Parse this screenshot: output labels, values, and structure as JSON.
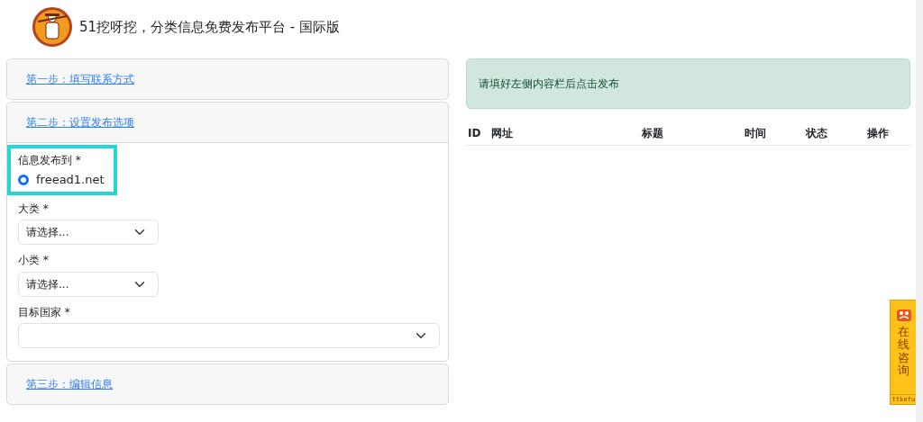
{
  "header": {
    "title": "51挖呀挖，分类信息免费发布平台 - 国际版"
  },
  "steps": [
    {
      "title": "第一步：填写联系方式",
      "expanded": false
    },
    {
      "title": "第二步：设置发布选项",
      "expanded": true
    },
    {
      "title": "第三步：编辑信息",
      "expanded": false
    }
  ],
  "publish_to": {
    "label": "信息发布到 *",
    "options": [
      {
        "label": "freead1.net",
        "selected": true
      }
    ]
  },
  "fields": [
    {
      "label": "大类 *",
      "value": "请选择...",
      "kind": "short"
    },
    {
      "label": "小类 *",
      "value": "请选择...",
      "kind": "short"
    },
    {
      "label": "目标国家 *",
      "kind": "wide"
    }
  ],
  "alert": "请填好左侧内容栏后点击发布",
  "table": {
    "columns": [
      "ID",
      "网址",
      "标题",
      "时间",
      "状态",
      "操作"
    ]
  },
  "chat_widget": {
    "label": "在线咨询",
    "footer": "ttkefu"
  }
}
